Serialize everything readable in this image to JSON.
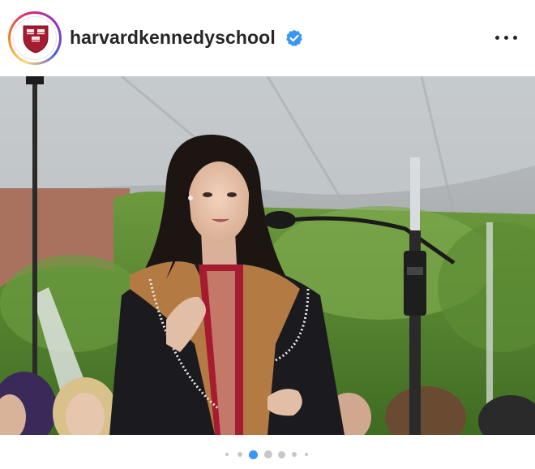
{
  "post": {
    "username": "harvardkennedyschool",
    "verified": true,
    "avatar_icon": "harvard-shield-icon",
    "more_icon": "more-options-icon"
  },
  "photo": {
    "subject": "graduate-speaking-at-podium"
  },
  "carousel": {
    "total": 7,
    "active_index": 2
  },
  "colors": {
    "brand_red": "#a51c30",
    "verified_blue": "#3897f0",
    "active_dot": "#3897f0",
    "inactive_dot": "#c7c7c7"
  }
}
